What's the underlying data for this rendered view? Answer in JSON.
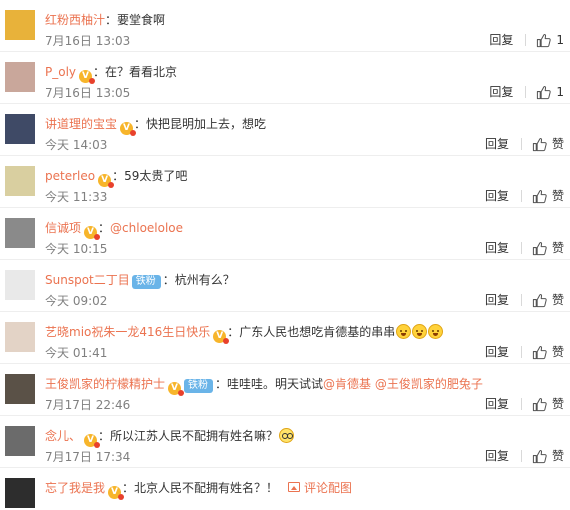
{
  "comments": [
    {
      "user": "红粉西柚汁",
      "vip": false,
      "fan_badge": "",
      "text_before": "：要堂食啊",
      "mention": "",
      "text_after": "",
      "emojis": 0,
      "time": "7月16日 13:03",
      "reply_label": "回复",
      "like_label": "1",
      "avatar_color": "#e8b23a"
    },
    {
      "user": "P_oly",
      "vip": true,
      "fan_badge": "",
      "text_before": "：在？看看北京",
      "mention": "",
      "text_after": "",
      "emojis": 0,
      "time": "7月16日 13:05",
      "reply_label": "回复",
      "like_label": "1",
      "avatar_color": "#c9a79b"
    },
    {
      "user": "讲道理的宝宝",
      "vip": true,
      "fan_badge": "",
      "text_before": "：快把昆明加上去，想吃",
      "mention": "",
      "text_after": "",
      "emojis": 0,
      "time": "今天 14:03",
      "reply_label": "回复",
      "like_label": "赞",
      "avatar_color": "#3f4a66"
    },
    {
      "user": "peterleo",
      "vip": true,
      "fan_badge": "",
      "text_before": "：59太贵了吧",
      "mention": "",
      "text_after": "",
      "emojis": 0,
      "time": "今天 11:33",
      "reply_label": "回复",
      "like_label": "赞",
      "avatar_color": "#d9cfa0"
    },
    {
      "user": "信诚项",
      "vip": true,
      "fan_badge": "",
      "text_before": "：",
      "mention": "@chloeloloe",
      "text_after": "",
      "emojis": 0,
      "time": "今天 10:15",
      "reply_label": "回复",
      "like_label": "赞",
      "avatar_color": "#8a8a8a"
    },
    {
      "user": "Sunspot二丁目",
      "vip": false,
      "fan_badge": "铁粉",
      "text_before": "：杭州有么？",
      "mention": "",
      "text_after": "",
      "emojis": 0,
      "time": "今天 09:02",
      "reply_label": "回复",
      "like_label": "赞",
      "avatar_color": "#e9e9e9"
    },
    {
      "user": "艺晓mio祝朱一龙416生日快乐",
      "vip": true,
      "fan_badge": "",
      "text_before": "：广东人民也想吃肯德基的串串",
      "mention": "",
      "text_after": "",
      "emojis": 3,
      "time": "今天 01:41",
      "reply_label": "回复",
      "like_label": "赞",
      "avatar_color": "#e3d3c6"
    },
    {
      "user": "王俊凯家的柠檬精护士",
      "vip": true,
      "fan_badge": "铁粉",
      "text_before": "：哇哇哇。明天试试",
      "mention": "@肯德基 @王俊凯家的肥兔子",
      "text_after": "",
      "emojis": 0,
      "time": "7月17日 22:46",
      "reply_label": "回复",
      "like_label": "赞",
      "avatar_color": "#5a5147"
    },
    {
      "user": "念儿、",
      "vip": true,
      "fan_badge": "",
      "text_before": "：所以江苏人民不配拥有姓名嘛？",
      "mention": "",
      "text_after": "",
      "emojis": 0,
      "time": "7月17日 17:34",
      "reply_label": "回复",
      "like_label": "赞",
      "avatar_color": "#6b6b6b"
    },
    {
      "user": "忘了我是我",
      "vip": true,
      "fan_badge": "",
      "text_before": "：北京人民不配拥有姓名？！",
      "mention": "",
      "text_after": "",
      "emojis": 0,
      "time": "",
      "reply_label": "",
      "like_label": "",
      "avatar_color": "#2d2d2d",
      "pic_link": "评论配图"
    }
  ],
  "colors": {
    "accent": "#eb7350",
    "time": "#808080",
    "fan_badge": "#6ab4e8"
  },
  "icons": {
    "like": "thumbs-up-icon",
    "vip": "vip-badge-icon",
    "pic": "image-icon"
  }
}
